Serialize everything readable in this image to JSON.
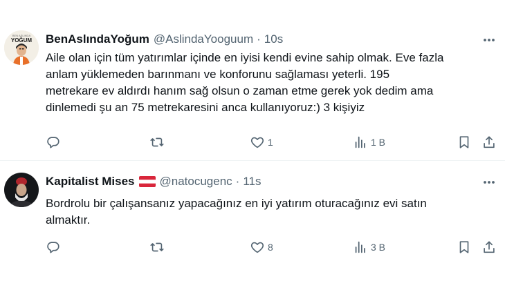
{
  "tweets": [
    {
      "display_name": "BenAslındaYoğum",
      "handle": "@AslindaYooguum",
      "separator": "·",
      "time": "10s",
      "avatar_text_top": "BEN ASLINDA",
      "avatar_text_main": "YOĞUM",
      "text_lines": [
        "Aile olan için tüm yatırımlar içinde en iyisi kendi evine sahip olmak. Eve fazla",
        "anlam yüklemeden barınmanı ve konforunu sağlaması yeterli. 195",
        "metrekare ev aldırdı hanım sağ olsun o zaman etme gerek yok dedim ama",
        "dinlemedi şu an 75 metrekaresini anca kullanıyoruz:) 3 kişiyiz"
      ],
      "stats": {
        "replies": "",
        "retweets": "",
        "likes": "1",
        "views": "1 B"
      }
    },
    {
      "display_name": "Kapitalist Mises",
      "handle": "@natocugenc",
      "separator": "·",
      "time": "11s",
      "flag": "austria-flag",
      "text_lines": [
        "Bordrolu bir çalışansanız yapacağınız en iyi yatırım oturacağınız evi satın",
        "almaktır."
      ],
      "stats": {
        "replies": "",
        "retweets": "",
        "likes": "8",
        "views": "3 B"
      }
    }
  ],
  "icons": [
    "more-icon",
    "reply-icon",
    "retweet-icon",
    "like-icon",
    "views-icon",
    "bookmark-icon",
    "share-icon"
  ],
  "colors": {
    "text": "#0f1419",
    "secondary": "#536471",
    "divider": "#eff3f4",
    "flag_red": "#d9263b"
  }
}
